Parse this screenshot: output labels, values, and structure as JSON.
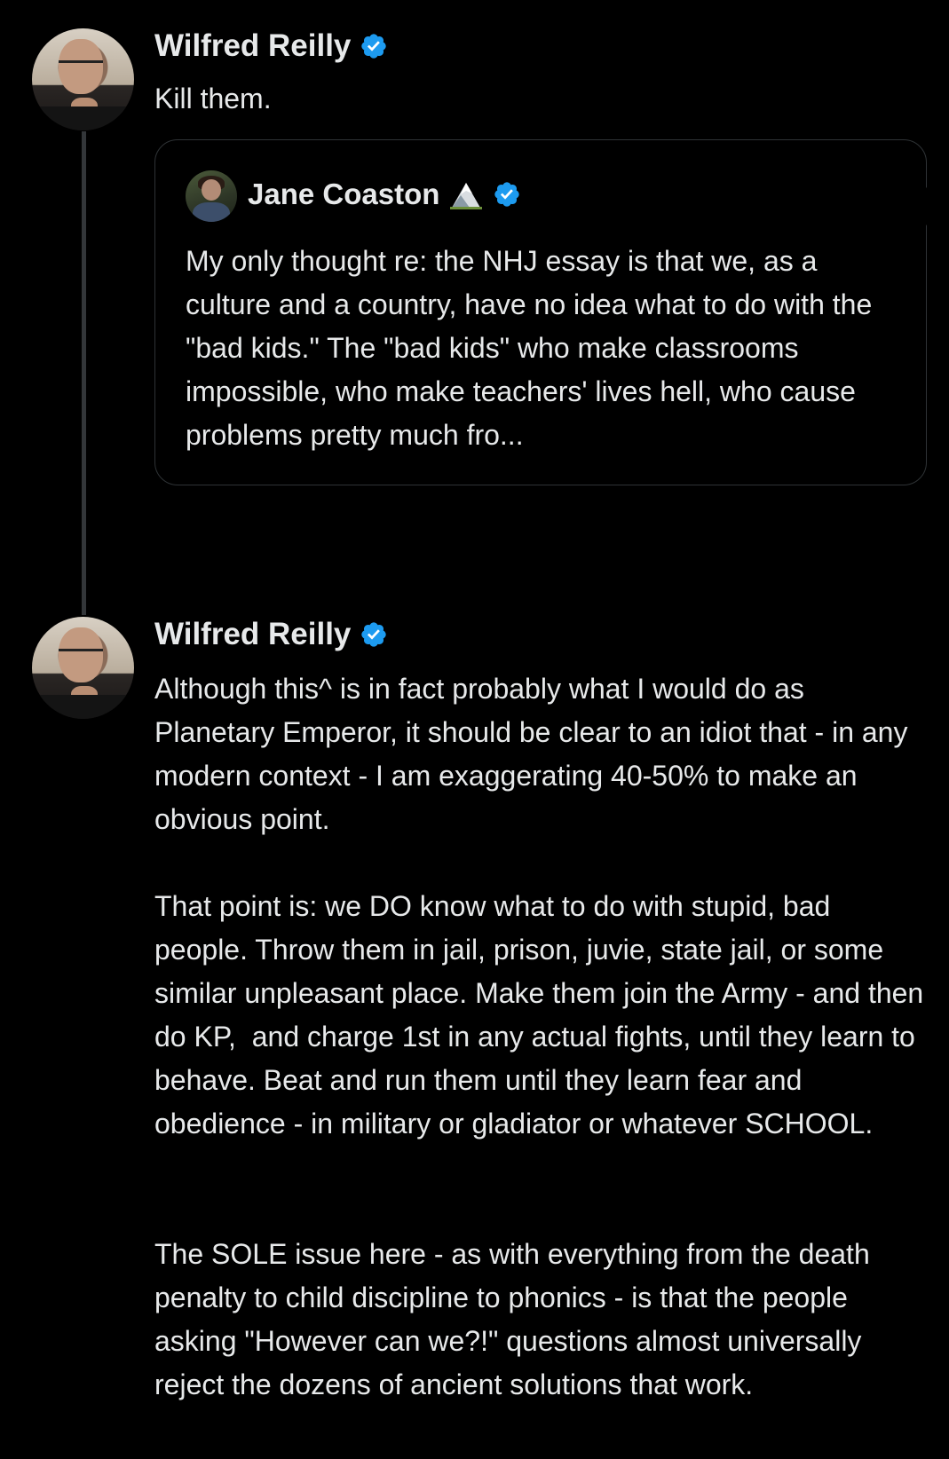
{
  "thread": {
    "first_tweet": {
      "author": "Wilfred Reilly",
      "verified": true,
      "text": "Kill them.",
      "avatar_icon": "profile-photo",
      "quote": {
        "author": "Jane Coaston",
        "emoji": "mountain-emoji",
        "verified": true,
        "text": "My only thought re: the NHJ essay is that we, as a culture and a country, have no idea what to do with the \"bad kids.\" The \"bad kids\" who make classrooms impossible, who make teachers' lives hell, who cause problems pretty much fro..."
      }
    },
    "second_tweet": {
      "author": "Wilfred Reilly",
      "verified": true,
      "avatar_icon": "profile-photo",
      "paragraphs": [
        "Although this^ is in fact probably what I would do as Planetary Emperor, it should be clear to an idiot that - in any modern context - I am exaggerating 40-50% to make an obvious point.",
        "That point is: we DO know what to do with stupid, bad people. Throw them in jail, prison, juvie, state jail, or some similar unpleasant place. Make them join the Army - and then do KP,  and charge 1st in any actual fights, until they learn to behave. Beat and run them until they learn fear and obedience - in military or gladiator or whatever SCHOOL.",
        "The SOLE issue here - as with everything from the death penalty to child discipline to phonics - is that the people asking \"However can we?!\" questions almost universally reject the dozens of ancient solutions that work."
      ]
    }
  },
  "colors": {
    "background": "#000000",
    "text": "#e7e9ea",
    "verified_badge": "#1d9bf0",
    "border": "#2f3336"
  }
}
